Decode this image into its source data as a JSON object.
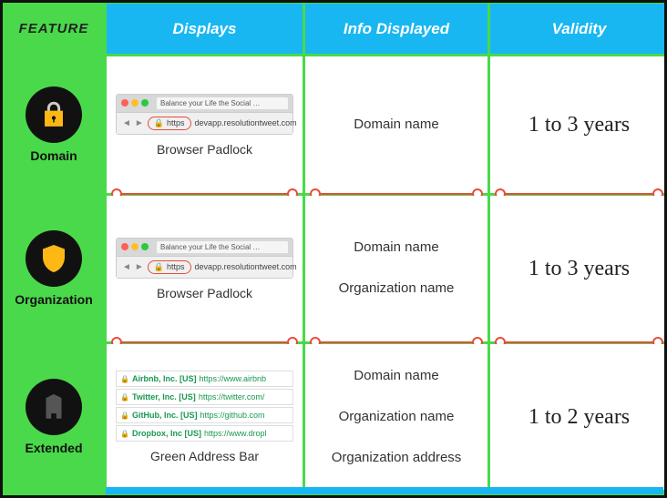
{
  "headers": {
    "feature": "FEATURE",
    "displays": "Displays",
    "info": "Info Displayed",
    "validity": "Validity"
  },
  "rows": [
    {
      "feature_label": "Domain",
      "display_caption": "Browser Padlock",
      "browser_tab": "Balance your Life the Social …",
      "browser_proto": "https",
      "browser_host": "devapp.resolutiontweet.com",
      "info_lines": [
        "Domain name"
      ],
      "validity": "1 to 3 years"
    },
    {
      "feature_label": "Organization",
      "display_caption": "Browser Padlock",
      "browser_tab": "Balance your Life the Social …",
      "browser_proto": "https",
      "browser_host": "devapp.resolutiontweet.com",
      "info_lines": [
        "Domain name",
        "Organization name"
      ],
      "validity": "1 to 3 years"
    },
    {
      "feature_label": "Extended",
      "display_caption": "Green Address Bar",
      "green_items": [
        {
          "org": "Airbnb, Inc. [US]",
          "url": "https://www.airbnb"
        },
        {
          "org": "Twitter, Inc. [US]",
          "url": "https://twitter.com/"
        },
        {
          "org": "GitHub, Inc. [US]",
          "url": "https://github.com"
        },
        {
          "org": "Dropbox, Inc [US]",
          "url": "https://www.dropl"
        }
      ],
      "info_lines": [
        "Domain name",
        "Organization name",
        "Organization address"
      ],
      "validity": "1 to 2 years"
    }
  ]
}
